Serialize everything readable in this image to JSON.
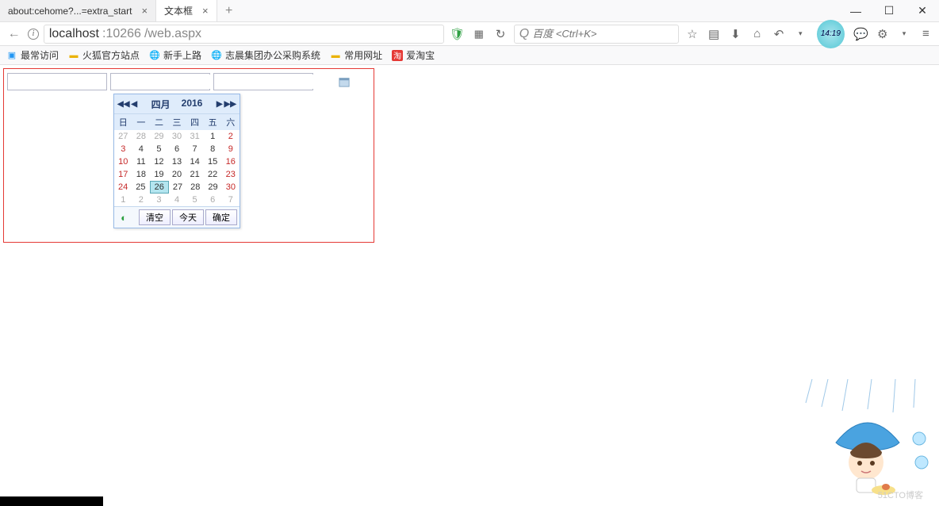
{
  "tabs": [
    {
      "title": "about:cehome?...=extra_start",
      "active": false
    },
    {
      "title": "文本框",
      "active": true
    }
  ],
  "window_buttons": {
    "min": "—",
    "max": "☐",
    "close": "✕"
  },
  "nav": {
    "back": "←",
    "forward": "→"
  },
  "url": {
    "host": "localhost",
    "port": ":10266",
    "path": "/web.aspx"
  },
  "addr_icons": {
    "shield": "🛡",
    "qr": "▦",
    "reload": "↻"
  },
  "search": {
    "engine_icon": "Q",
    "placeholder": "百度 <Ctrl+K>"
  },
  "toolbar": {
    "star": "☆",
    "reader": "▤",
    "download": "⬇",
    "home": "⌂",
    "undo": "↶",
    "drop": "▾",
    "clock": "14:19",
    "chat": "💬",
    "plugin": "⚙",
    "menu_drop": "▾",
    "hamburger": "≡"
  },
  "bookmarks": [
    {
      "icon": "fx",
      "label": "最常访问"
    },
    {
      "icon": "folder",
      "label": "火狐官方站点"
    },
    {
      "icon": "globe",
      "label": "新手上路"
    },
    {
      "icon": "globe",
      "label": "志晨集团办公采购系统"
    },
    {
      "icon": "folder",
      "label": "常用网址"
    },
    {
      "icon": "tao",
      "label": "爱淘宝"
    }
  ],
  "calendar": {
    "nav": {
      "prevYear": "◀◀",
      "prevMonth": "◀",
      "nextMonth": "▶",
      "nextYear": "▶▶"
    },
    "month": "四月",
    "year": "2016",
    "dow": [
      "日",
      "一",
      "二",
      "三",
      "四",
      "五",
      "六"
    ],
    "weeks": [
      [
        {
          "d": "27",
          "o": true
        },
        {
          "d": "28",
          "o": true
        },
        {
          "d": "29",
          "o": true
        },
        {
          "d": "30",
          "o": true
        },
        {
          "d": "31",
          "o": true
        },
        {
          "d": "1"
        },
        {
          "d": "2",
          "we": true
        }
      ],
      [
        {
          "d": "3",
          "we": true
        },
        {
          "d": "4"
        },
        {
          "d": "5"
        },
        {
          "d": "6"
        },
        {
          "d": "7"
        },
        {
          "d": "8"
        },
        {
          "d": "9",
          "we": true
        }
      ],
      [
        {
          "d": "10",
          "we": true
        },
        {
          "d": "11"
        },
        {
          "d": "12"
        },
        {
          "d": "13"
        },
        {
          "d": "14"
        },
        {
          "d": "15"
        },
        {
          "d": "16",
          "we": true
        }
      ],
      [
        {
          "d": "17",
          "we": true
        },
        {
          "d": "18"
        },
        {
          "d": "19"
        },
        {
          "d": "20"
        },
        {
          "d": "21"
        },
        {
          "d": "22"
        },
        {
          "d": "23",
          "we": true
        }
      ],
      [
        {
          "d": "24",
          "we": true
        },
        {
          "d": "25"
        },
        {
          "d": "26",
          "today": true
        },
        {
          "d": "27"
        },
        {
          "d": "28"
        },
        {
          "d": "29"
        },
        {
          "d": "30",
          "we": true
        }
      ],
      [
        {
          "d": "1",
          "o": true
        },
        {
          "d": "2",
          "o": true
        },
        {
          "d": "3",
          "o": true
        },
        {
          "d": "4",
          "o": true
        },
        {
          "d": "5",
          "o": true
        },
        {
          "d": "6",
          "o": true
        },
        {
          "d": "7",
          "o": true
        }
      ]
    ],
    "buttons": {
      "clear": "清空",
      "today": "今天",
      "ok": "确定"
    }
  },
  "watermark": "51CTO博客",
  "tao_char": "淘"
}
